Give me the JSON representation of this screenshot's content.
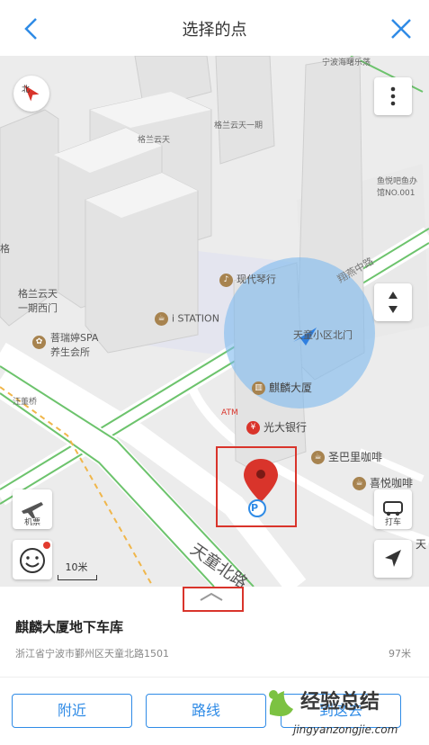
{
  "header": {
    "title": "选择的点"
  },
  "map": {
    "pois": {
      "ningbo_playground": "宁波海曙乐荡",
      "gelan_yunyiqi": "格兰云天一期",
      "gelan_yuntian": "格兰云天",
      "yuyueba_1": "鱼悦吧鱼办",
      "yuyueba_2": "馆NO.001",
      "gelan_west_1": "格兰云天",
      "gelan_west_2": "一期西门",
      "xiandai_qinxing": "现代琴行",
      "i_station": "i STATION",
      "puruiting_1": "菩瑞婷SPA",
      "puruiting_2": "养生会所",
      "xiaoqu_north": "天童小区北门",
      "wangdongqiao": "汪董桥",
      "qilin_dasha": "麒麟大厦",
      "atm": "ATM",
      "guangda_bank": "光大银行",
      "shengbali": "圣巴里咖啡",
      "xiyue": "喜悦咖啡",
      "tian_edge": "天",
      "ge_edge": "格",
      "road_name": "天童北路",
      "road_name_2": "翔燕中路",
      "parking": "P"
    },
    "buttons": {
      "compass": "北",
      "flight": "机票",
      "taxi": "打车"
    },
    "scale": "10米"
  },
  "place": {
    "name": "麒麟大厦地下车库",
    "address": "浙江省宁波市鄞州区天童北路1501",
    "distance": "97米"
  },
  "actions": {
    "nearby": "附近",
    "route": "路线",
    "go": "到这去"
  },
  "watermark": {
    "top": "经验总结",
    "bottom": "jingyanzongjie.com"
  },
  "colors": {
    "accent": "#2f8be6",
    "pin": "#d9342b",
    "highlight": "#d9342b"
  }
}
